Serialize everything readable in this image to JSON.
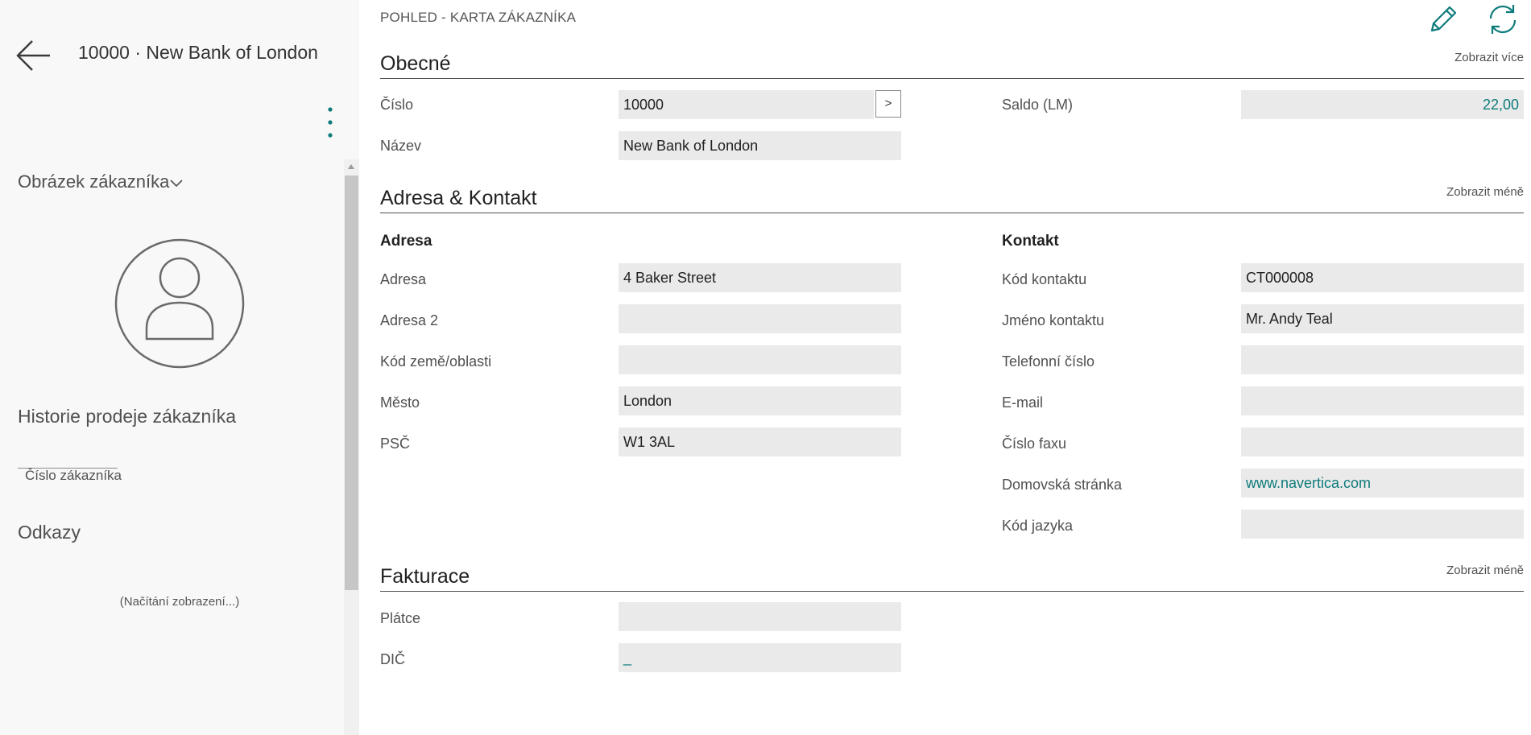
{
  "header": {
    "caption": "10000 · New Bank of London",
    "view_title": "POHLED - KARTA ZÁKAZNÍKA"
  },
  "factbox": {
    "picture_title": "Obrázek zákazníka",
    "sales_history_title": "Historie prodeje zákazníka",
    "customer_no_label": "Číslo zákazníka",
    "links_title": "Odkazy",
    "loading_text": "(Načítání zobrazení...)"
  },
  "sections": {
    "general": {
      "title": "Obecné",
      "toggle": "Zobrazit více",
      "fields": {
        "no_label": "Číslo",
        "no_value": "10000",
        "name_label": "Název",
        "name_value": "New Bank of London",
        "balance_label": "Saldo (LM)",
        "balance_value": "22,00"
      },
      "assist_button": ">"
    },
    "address_contact": {
      "title": "Adresa & Kontakt",
      "toggle": "Zobrazit méně",
      "address_heading": "Adresa",
      "contact_heading": "Kontakt",
      "address_fields": [
        {
          "label": "Adresa",
          "value": "4 Baker Street"
        },
        {
          "label": "Adresa 2",
          "value": ""
        },
        {
          "label": "Kód země/oblasti",
          "value": ""
        },
        {
          "label": "Město",
          "value": "London"
        },
        {
          "label": "PSČ",
          "value": "W1 3AL"
        }
      ],
      "contact_fields": [
        {
          "label": "Kód kontaktu",
          "value": "CT000008"
        },
        {
          "label": "Jméno kontaktu",
          "value": "Mr. Andy Teal"
        },
        {
          "label": "Telefonní číslo",
          "value": ""
        },
        {
          "label": "E-mail",
          "value": ""
        },
        {
          "label": "Číslo faxu",
          "value": ""
        },
        {
          "label": "Domovská stránka",
          "value": "www.navertica.com"
        },
        {
          "label": "Kód jazyka",
          "value": ""
        }
      ]
    },
    "invoicing": {
      "title": "Fakturace",
      "toggle": "Zobrazit méně",
      "fields": {
        "payer_label": "Plátce",
        "payer_value": "",
        "vat_label": "DIČ",
        "vat_value": "_"
      }
    }
  },
  "icons": {
    "back": "back-arrow-icon",
    "more": "more-options-icon",
    "edit": "pencil-icon",
    "refresh": "refresh-icon",
    "avatar": "person-icon",
    "chevron": "chevron-down-icon"
  },
  "colors": {
    "accent": "#0e7b7b",
    "field_bg": "#eaeaea",
    "pane_bg": "#f8f8f8"
  }
}
